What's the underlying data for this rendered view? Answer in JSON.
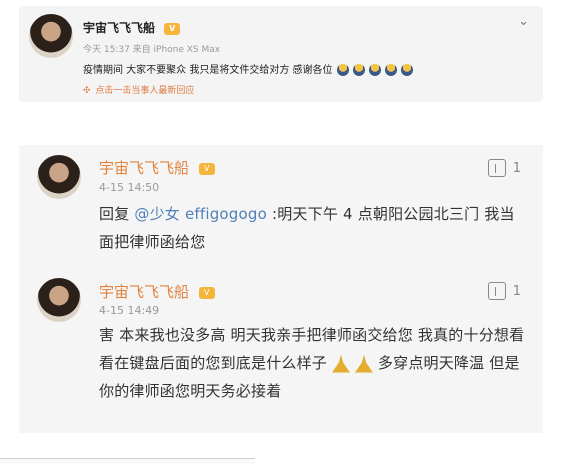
{
  "post": {
    "author": "宇宙飞飞飞船",
    "meta": "今天 15:37 来自 iPhone XS Max",
    "text": "疫情期间 大家不要聚众 我只是将文件交给对方 感谢各位",
    "action": "点击一击当事人最新回应"
  },
  "comments": [
    {
      "author": "宇宙飞飞飞船",
      "date": "4-15 14:50",
      "likes": "1",
      "prefix": "回复",
      "mention": "@少女 effigogogo",
      "text": ":明天下午 4 点朝阳公园北三门 我当面把律师函给您"
    },
    {
      "author": "宇宙飞飞飞船",
      "date": "4-15 14:49",
      "likes": "1",
      "text_part1": "害 本来我也没多高 明天我亲手把律师函交给您 我真的十分想看看在键盘后面的您到底是什么样子",
      "text_part2": "多穿点明天降温 但是你的律师函您明天务必接着"
    }
  ]
}
